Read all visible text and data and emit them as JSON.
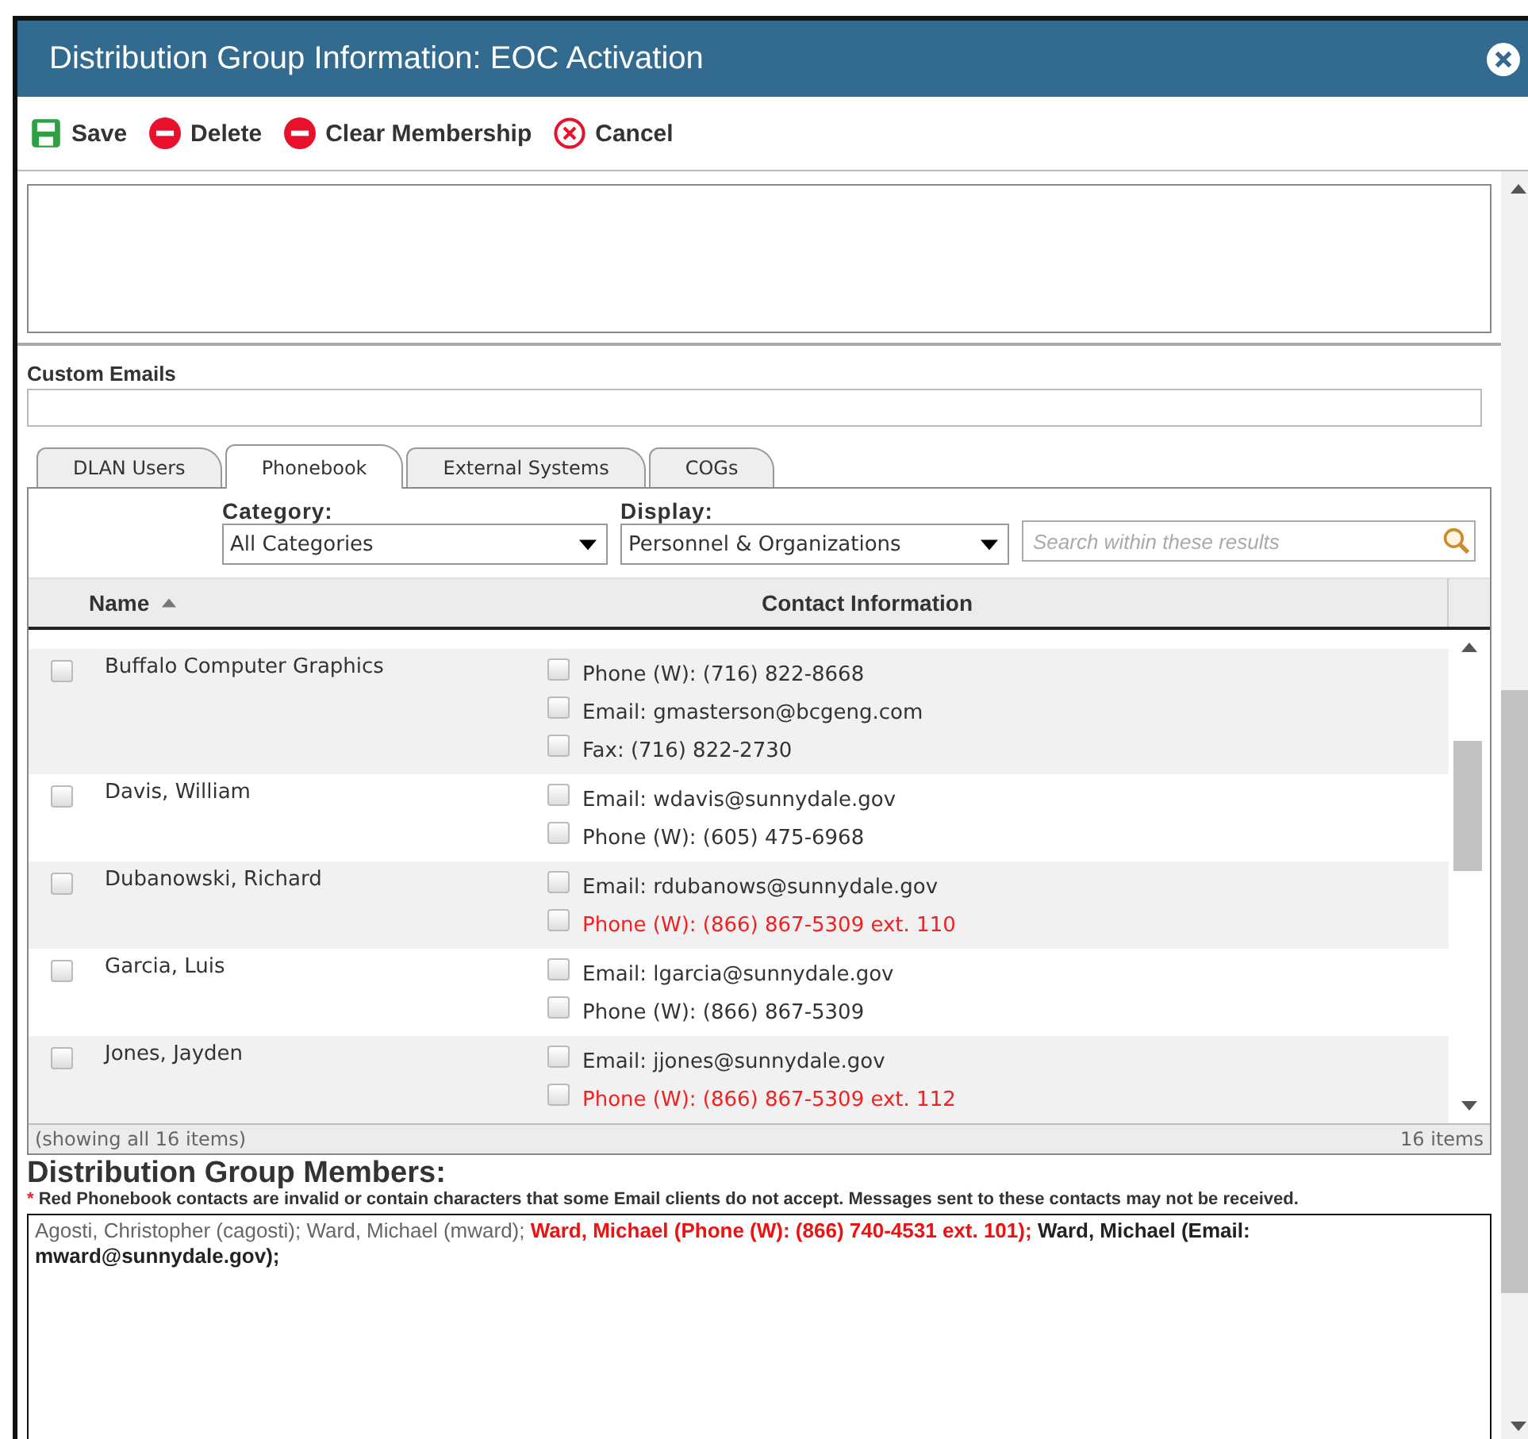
{
  "window": {
    "title": "Distribution Group Information: EOC Activation"
  },
  "toolbar": [
    {
      "kind": "save",
      "label": "Save"
    },
    {
      "kind": "delete",
      "label": "Delete"
    },
    {
      "kind": "delete",
      "label": "Clear Membership"
    },
    {
      "kind": "cancel",
      "label": "Cancel"
    }
  ],
  "custom_emails": {
    "label": "Custom Emails"
  },
  "tabs": [
    {
      "label": "DLAN Users",
      "selected": false
    },
    {
      "label": "Phonebook",
      "selected": true
    },
    {
      "label": "External Systems",
      "selected": false
    },
    {
      "label": "COGs",
      "selected": false
    }
  ],
  "filters": {
    "category": {
      "label": "Category:",
      "value": "All Categories"
    },
    "display": {
      "label": "Display:",
      "value": "Personnel & Organizations"
    },
    "search": {
      "placeholder": "Search within these results"
    }
  },
  "table": {
    "columns": [
      {
        "label": "Name",
        "sorted": true
      },
      {
        "label": "Contact Information",
        "sorted": false
      }
    ],
    "rows": [
      {
        "name": "Buffalo Computer Graphics",
        "checked": false,
        "contacts": [
          {
            "text": "Phone (W): (716) 822-8668",
            "checked": false,
            "invalid": false
          },
          {
            "text": "Email: gmasterson@bcgeng.com",
            "checked": false,
            "invalid": false
          },
          {
            "text": "Fax: (716) 822-2730",
            "checked": false,
            "invalid": false
          }
        ]
      },
      {
        "name": "Davis, William",
        "checked": false,
        "contacts": [
          {
            "text": "Email: wdavis@sunnydale.gov",
            "checked": false,
            "invalid": false
          },
          {
            "text": "Phone (W): (605) 475-6968",
            "checked": false,
            "invalid": false
          }
        ]
      },
      {
        "name": "Dubanowski, Richard",
        "checked": false,
        "contacts": [
          {
            "text": "Email: rdubanows@sunnydale.gov",
            "checked": false,
            "invalid": false
          },
          {
            "text": "Phone (W): (866) 867-5309 ext. 110",
            "checked": false,
            "invalid": true
          }
        ]
      },
      {
        "name": "Garcia, Luis",
        "checked": false,
        "contacts": [
          {
            "text": "Email: lgarcia@sunnydale.gov",
            "checked": false,
            "invalid": false
          },
          {
            "text": "Phone (W): (866) 867-5309",
            "checked": false,
            "invalid": false
          }
        ]
      },
      {
        "name": "Jones, Jayden",
        "checked": false,
        "contacts": [
          {
            "text": "Email: jjones@sunnydale.gov",
            "checked": false,
            "invalid": false
          },
          {
            "text": "Phone (W): (866) 867-5309 ext. 112",
            "checked": false,
            "invalid": true
          }
        ]
      }
    ],
    "footer": {
      "showing": "(showing all 16 items)",
      "count": "16 items"
    }
  },
  "members": {
    "title": "Distribution Group Members:",
    "note_mark": "*",
    "note": "Red Phonebook contacts are invalid or contain characters that some Email clients do not accept. Messages sent to these contacts may not be received.",
    "items": [
      {
        "text": "Agosti, Christopher (cagosti);",
        "kind": "user",
        "invalid": false
      },
      {
        "text": "Ward, Michael (mward);",
        "kind": "user",
        "invalid": false
      },
      {
        "text": "Ward, Michael (Phone (W): (866) 740-4531 ext. 101);",
        "kind": "contact",
        "invalid": true
      },
      {
        "text": "Ward, Michael (Email: mward@sunnydale.gov);",
        "kind": "contact",
        "invalid": false
      }
    ]
  }
}
